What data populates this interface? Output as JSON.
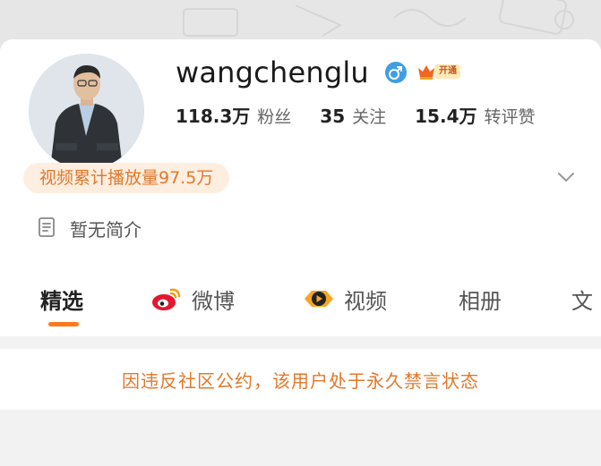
{
  "profile": {
    "username": "wangchenglu",
    "vip_badge": "开通",
    "video_plays": "视频累计播放量97.5万",
    "bio": "暂无简介"
  },
  "stats": [
    {
      "value": "118.3万",
      "label": "粉丝"
    },
    {
      "value": "35",
      "label": "关注"
    },
    {
      "value": "15.4万",
      "label": "转评赞"
    }
  ],
  "tabs": [
    {
      "label": "精选",
      "active": true
    },
    {
      "label": "微博",
      "icon": "weibo-icon"
    },
    {
      "label": "视频",
      "icon": "video-icon"
    },
    {
      "label": "相册"
    },
    {
      "label": "文"
    }
  ],
  "ban_notice": "因违反社区公约，该用户处于永久禁言状态",
  "colors": {
    "accent": "#ff7a1a",
    "notice": "#e2782c",
    "gender": "#3f9ee6"
  },
  "icons": [
    "gender-male-icon",
    "vip-crown-icon",
    "chevron-down-icon",
    "document-icon",
    "weibo-icon",
    "video-icon"
  ]
}
